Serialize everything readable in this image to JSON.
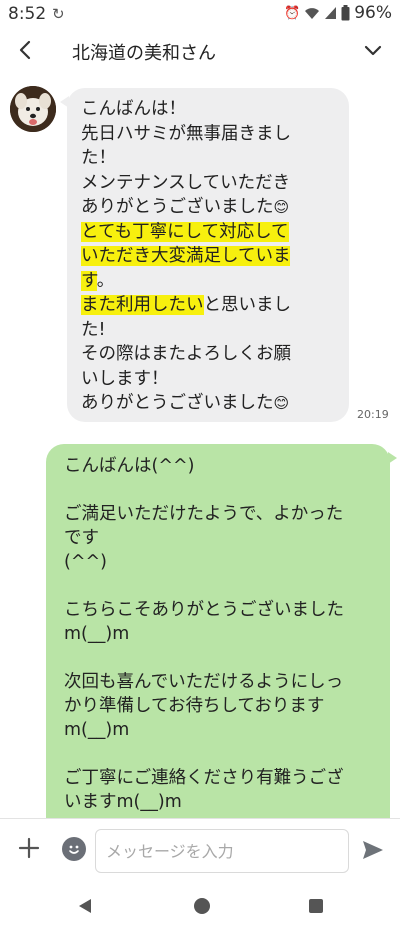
{
  "status_bar": {
    "time": "8:52",
    "battery": "96%"
  },
  "header": {
    "title": "北海道の美和さん"
  },
  "incoming_message": {
    "lines": [
      "こんばんは！",
      "先日ハサミが無事届きまし",
      "た！",
      "メンテナンスしていただき",
      "ありがとうございました",
      "とても丁寧にして対応して",
      "いただき大変満足していま",
      "す",
      "。",
      "また利用したい",
      "と思いまし",
      "た!",
      "その際はまたよろしくお願",
      "いします！",
      "ありがとうございました"
    ],
    "time": "20:19"
  },
  "outgoing_message": {
    "lines": [
      "こんばんは(^^)",
      "",
      "ご満足いただけたようで、よかった",
      "です",
      "(^^)",
      "",
      "こちらこそありがとうございました",
      "m(__)m",
      "",
      "次回も喜んでいただけるようにしっ",
      "かり準備してお待ちしております",
      "m(__)m",
      "",
      "ご丁寧にご連絡くださり有難うござ",
      "いますm(__)m"
    ]
  },
  "input_bar": {
    "placeholder": "メッセージを入力"
  },
  "colors": {
    "highlight": "#f7f00e",
    "incoming_bubble": "#eeeeef",
    "outgoing_bubble": "#b9e4a6"
  },
  "icons": {
    "back": "chevron-left-icon",
    "menu": "chevron-down-icon",
    "attach": "plus-icon",
    "sticker": "smile-icon",
    "send": "send-icon"
  }
}
